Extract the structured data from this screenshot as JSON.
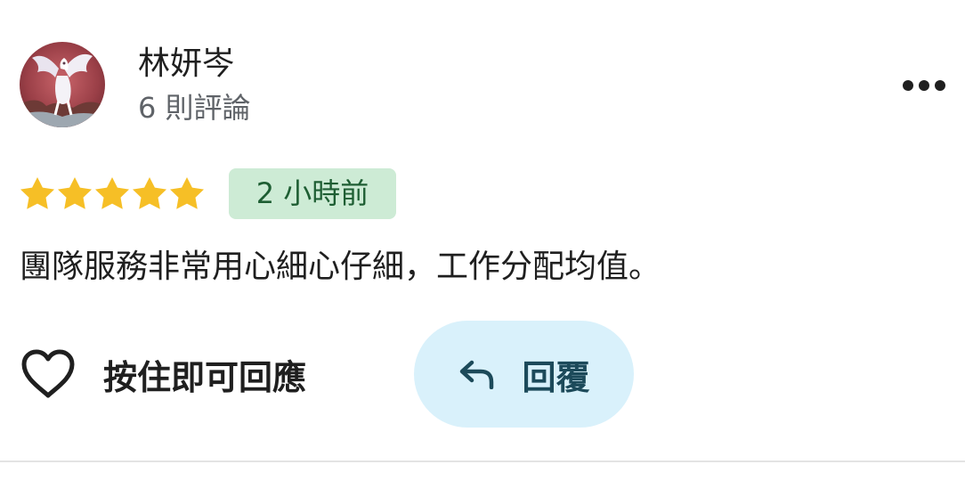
{
  "review": {
    "reviewer": {
      "name": "林妍岑",
      "review_count": "6 則評論",
      "avatar_icon": "pegasus-illustration-avatar"
    },
    "menu_icon": "more-horizontal-icon",
    "rating": {
      "stars": 5,
      "max": 5,
      "star_color": "#f6bf26"
    },
    "time_ago": "2 小時前",
    "text": "團隊服務非常用心細心仔細，工作分配均值。",
    "actions": {
      "like_icon": "heart-outline-icon",
      "like_label": "按住即可回應",
      "reply_icon": "reply-arrow-icon",
      "reply_label": "回覆"
    }
  },
  "colors": {
    "time_badge_bg": "#cdebd5",
    "time_badge_text": "#1e5e33",
    "reply_button_bg": "#d9f1fb",
    "reply_text": "#1c4a5a",
    "secondary_text": "#5f6368"
  }
}
